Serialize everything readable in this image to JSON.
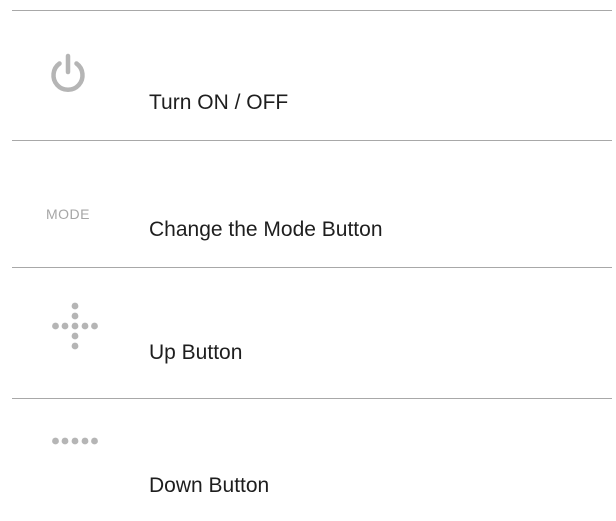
{
  "rows": [
    {
      "icon": "power-icon",
      "label": "Turn ON / OFF"
    },
    {
      "icon": "mode-icon",
      "icon_text": "MODE",
      "label": "Change the Mode Button"
    },
    {
      "icon": "up-dots-icon",
      "label": "Up Button"
    },
    {
      "icon": "down-dots-icon",
      "label": "Down Button"
    }
  ],
  "colors": {
    "icon_gray": "#b5b5b5",
    "divider": "#a8a8a8",
    "text": "#1e1e1e"
  }
}
